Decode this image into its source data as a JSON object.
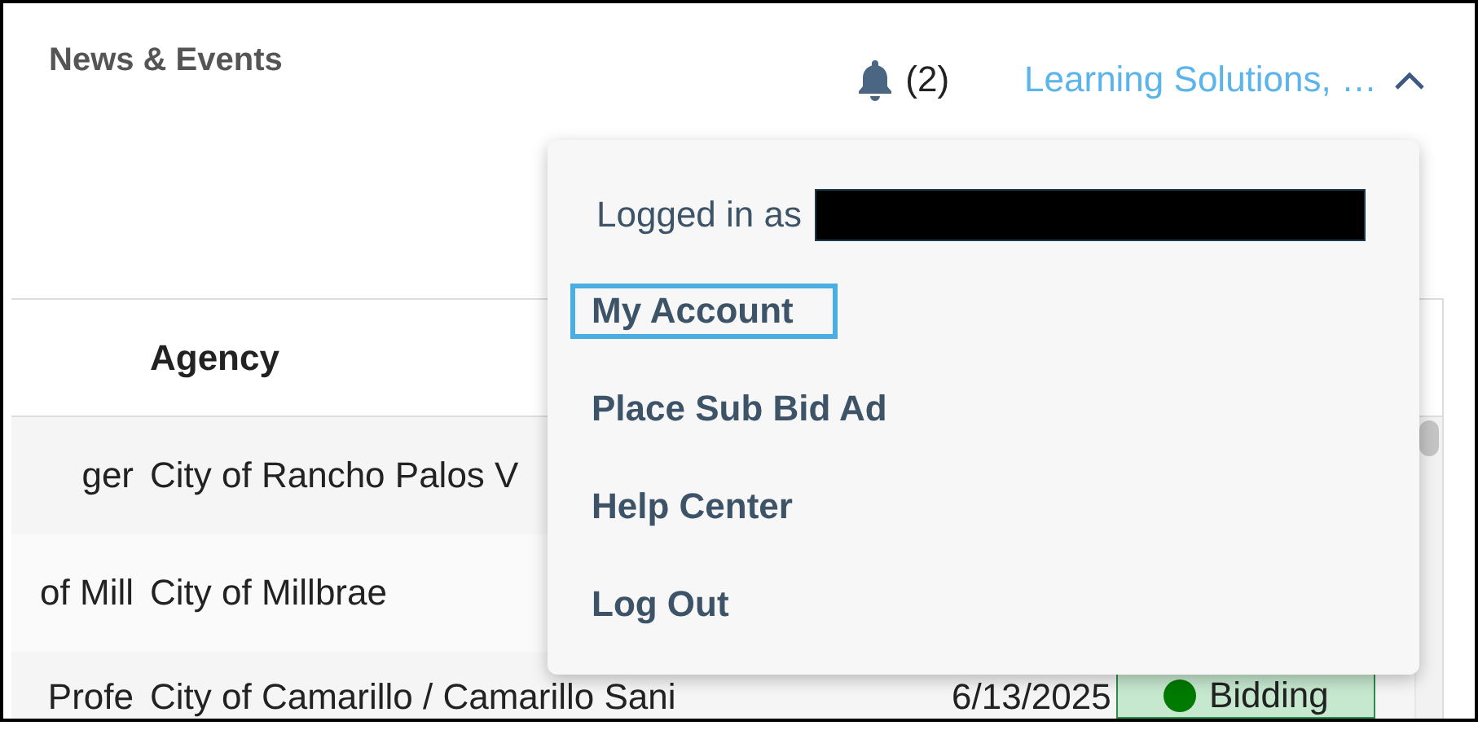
{
  "header": {
    "title": "News & Events",
    "notifications": "(2)",
    "account": "Learning Solutions, …",
    "menu_expanded": true
  },
  "table": {
    "columns": [
      "",
      "Agency",
      "",
      ""
    ],
    "rows": [
      {
        "cells": [
          "ger",
          "City of Rancho Palos V",
          "",
          ""
        ]
      },
      {
        "cells": [
          "of Mill",
          "City of Millbrae",
          "",
          ""
        ]
      },
      {
        "cells": [
          "Profe",
          "City of Camarillo / Camarillo Sani",
          "6/13/2025",
          {
            "status": "Bidding",
            "color": "#007a00"
          }
        ]
      }
    ]
  },
  "account_menu": {
    "logged_in_label": "Logged in as",
    "redacted": true,
    "items": [
      {
        "label": "My Account",
        "focused": true
      },
      {
        "label": "Place Sub Bid Ad",
        "focused": false
      },
      {
        "label": "Help Center",
        "focused": false
      },
      {
        "label": "Log Out",
        "focused": false
      }
    ]
  }
}
